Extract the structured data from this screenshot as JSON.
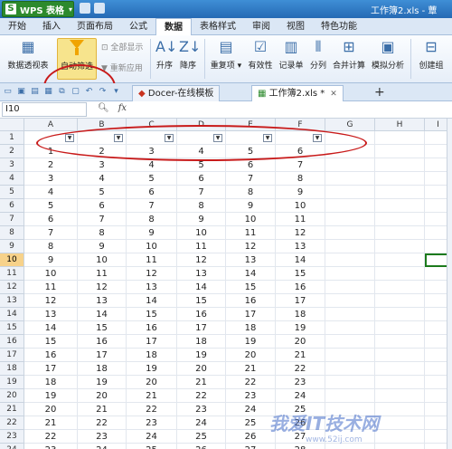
{
  "app": {
    "name": "WPS 表格",
    "logo": "S",
    "window_title": "工作簿2.xls - 蕈"
  },
  "menu": {
    "tabs": [
      "开始",
      "插入",
      "页面布局",
      "公式",
      "数据",
      "表格样式",
      "审阅",
      "视图",
      "特色功能"
    ],
    "active_index": 4
  },
  "ribbon": {
    "pivot": "数据透视表",
    "autofilter": "自动筛选",
    "show_all": "全部显示",
    "reapply": "重新应用",
    "sort_asc": "升序",
    "sort_desc": "降序",
    "duplicates": "重复项",
    "validity": "有效性",
    "record": "记录单",
    "split": "分列",
    "consolidate": "合并计算",
    "simulate": "模拟分析",
    "group": "创建组"
  },
  "doc_tabs": [
    {
      "label": "Docer-在线模板"
    },
    {
      "label": "工作簿2.xls *"
    }
  ],
  "formula_bar": {
    "name_box": "I10",
    "fx": "fx",
    "zoom_icon": "magnifier-icon"
  },
  "columns": [
    "A",
    "B",
    "C",
    "D",
    "E",
    "F",
    "G",
    "H",
    "I"
  ],
  "rows": [
    {
      "n": "1",
      "cells": [
        "",
        "",
        "",
        "",
        "",
        ""
      ]
    },
    {
      "n": "2",
      "cells": [
        "1",
        "2",
        "3",
        "4",
        "5",
        "6"
      ]
    },
    {
      "n": "3",
      "cells": [
        "2",
        "3",
        "4",
        "5",
        "6",
        "7"
      ]
    },
    {
      "n": "4",
      "cells": [
        "3",
        "4",
        "5",
        "6",
        "7",
        "8"
      ]
    },
    {
      "n": "5",
      "cells": [
        "4",
        "5",
        "6",
        "7",
        "8",
        "9"
      ]
    },
    {
      "n": "6",
      "cells": [
        "5",
        "6",
        "7",
        "8",
        "9",
        "10"
      ]
    },
    {
      "n": "7",
      "cells": [
        "6",
        "7",
        "8",
        "9",
        "10",
        "11"
      ]
    },
    {
      "n": "8",
      "cells": [
        "7",
        "8",
        "9",
        "10",
        "11",
        "12"
      ]
    },
    {
      "n": "9",
      "cells": [
        "8",
        "9",
        "10",
        "11",
        "12",
        "13"
      ]
    },
    {
      "n": "10",
      "cells": [
        "9",
        "10",
        "11",
        "12",
        "13",
        "14"
      ]
    },
    {
      "n": "11",
      "cells": [
        "10",
        "11",
        "12",
        "13",
        "14",
        "15"
      ]
    },
    {
      "n": "12",
      "cells": [
        "11",
        "12",
        "13",
        "14",
        "15",
        "16"
      ]
    },
    {
      "n": "13",
      "cells": [
        "12",
        "13",
        "14",
        "15",
        "16",
        "17"
      ]
    },
    {
      "n": "14",
      "cells": [
        "13",
        "14",
        "15",
        "16",
        "17",
        "18"
      ]
    },
    {
      "n": "15",
      "cells": [
        "14",
        "15",
        "16",
        "17",
        "18",
        "19"
      ]
    },
    {
      "n": "16",
      "cells": [
        "15",
        "16",
        "17",
        "18",
        "19",
        "20"
      ]
    },
    {
      "n": "17",
      "cells": [
        "16",
        "17",
        "18",
        "19",
        "20",
        "21"
      ]
    },
    {
      "n": "18",
      "cells": [
        "17",
        "18",
        "19",
        "20",
        "21",
        "22"
      ]
    },
    {
      "n": "19",
      "cells": [
        "18",
        "19",
        "20",
        "21",
        "22",
        "23"
      ]
    },
    {
      "n": "20",
      "cells": [
        "19",
        "20",
        "21",
        "22",
        "23",
        "24"
      ]
    },
    {
      "n": "21",
      "cells": [
        "20",
        "21",
        "22",
        "23",
        "24",
        "25"
      ]
    },
    {
      "n": "22",
      "cells": [
        "21",
        "22",
        "23",
        "24",
        "25",
        "26"
      ]
    },
    {
      "n": "23",
      "cells": [
        "22",
        "23",
        "24",
        "25",
        "26",
        "27"
      ]
    },
    {
      "n": "24",
      "cells": [
        "23",
        "24",
        "25",
        "26",
        "27",
        "28"
      ]
    },
    {
      "n": "25",
      "cells": [
        "24",
        "25",
        "26",
        "27",
        "28",
        "29"
      ]
    }
  ],
  "selected_row": "10",
  "watermark": {
    "text": "我爱IT技术网",
    "url": "www.52ij.com"
  },
  "colors": {
    "annotation": "#c81a1a",
    "accent": "#2569b4",
    "selection": "#1c7a1c"
  }
}
